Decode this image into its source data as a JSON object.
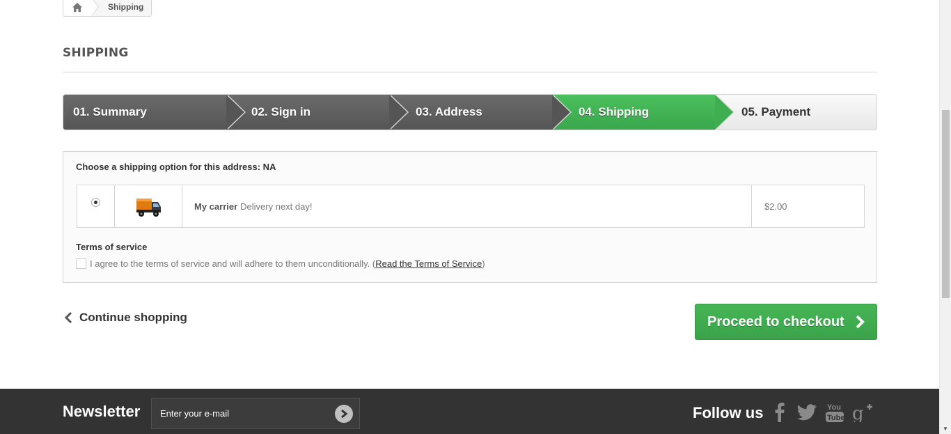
{
  "breadcrumb": {
    "home_icon": "home-icon",
    "current": "Shipping"
  },
  "page_heading": "SHIPPING",
  "steps": [
    {
      "label": "01. Summary",
      "state": "done"
    },
    {
      "label": "02. Sign in",
      "state": "done"
    },
    {
      "label": "03. Address",
      "state": "done"
    },
    {
      "label": "04. Shipping",
      "state": "current"
    },
    {
      "label": "05. Payment",
      "state": "todo"
    }
  ],
  "delivery": {
    "title": "Choose a shipping option for this address: NA",
    "carrier": {
      "selected": true,
      "logo_icon": "delivery-truck-icon",
      "name": "My carrier",
      "description": "Delivery next day!",
      "price": "$2.00"
    },
    "tos": {
      "title": "Terms of service",
      "agree_text": "I agree to the terms of service and will adhere to them unconditionally.",
      "open_paren": "(",
      "link_text": "Read the Terms of Service",
      "close_paren": ")",
      "checked": false
    }
  },
  "nav": {
    "continue_label": "Continue shopping",
    "proceed_label": "Proceed to checkout"
  },
  "footer": {
    "newsletter_label": "Newsletter",
    "newsletter_placeholder": "Enter your e-mail",
    "follow_label": "Follow us",
    "social_icons": [
      "facebook-icon",
      "twitter-icon",
      "youtube-icon",
      "google-plus-icon"
    ]
  },
  "colors": {
    "accent_green": "#3fae51",
    "step_dark": "#5f5f5f",
    "footer_bg": "#333333"
  }
}
